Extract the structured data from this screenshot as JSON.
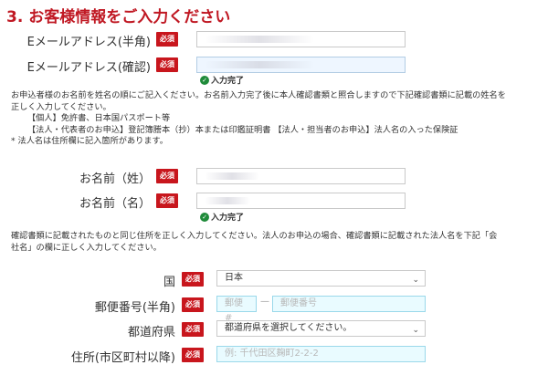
{
  "section": {
    "title": "3. お客様情報をご入力ください"
  },
  "required_label": "必須",
  "email": {
    "label": "Eメールアドレス(半角)"
  },
  "email_confirm": {
    "label": "Eメールアドレス(確認)",
    "status": "入力完了"
  },
  "name_note": {
    "line1": "お申込者様のお名前を姓名の順にご記入ください。お名前入力完了後に本人確認書類と照合しますので下記確認書類に記載の姓名を",
    "line2": "正しく入力してください。",
    "line3": "【個人】免許書、日本国パスポート等",
    "line4": "【法人・代表者のお申込】登記簿謄本（抄）本または印鑑証明書 【法人・担当者のお申込】法人名の入った保険証",
    "line5": "* 法人名は住所欄に記入箇所があります。"
  },
  "last_name": {
    "label": "お名前（姓）"
  },
  "first_name": {
    "label": "お名前（名）",
    "status": "入力完了"
  },
  "address_note": {
    "line1": "確認書類に記載されたものと同じ住所を正しく入力してください。法人のお申込の場合、確認書類に記載された法人名を下記「会",
    "line2": "社名」の欄に正しく入力してください。"
  },
  "country": {
    "label": "国",
    "value": "日本"
  },
  "postal": {
    "label": "郵便番号(半角)",
    "placeholder1": "郵便#",
    "placeholder2": "郵便番号",
    "separator": "—"
  },
  "prefecture": {
    "label": "都道府県",
    "value": "都道府県を選択してください。"
  },
  "address": {
    "label": "住所(市区町村以降)",
    "placeholder": "例: 千代田区麹町2-2-2"
  },
  "icons": {
    "status": "check-circle-icon",
    "dropdown": "chevron-down-icon"
  },
  "colors": {
    "accent": "#c01823",
    "required_badge": "#c8161d",
    "success": "#1f8b3a"
  }
}
